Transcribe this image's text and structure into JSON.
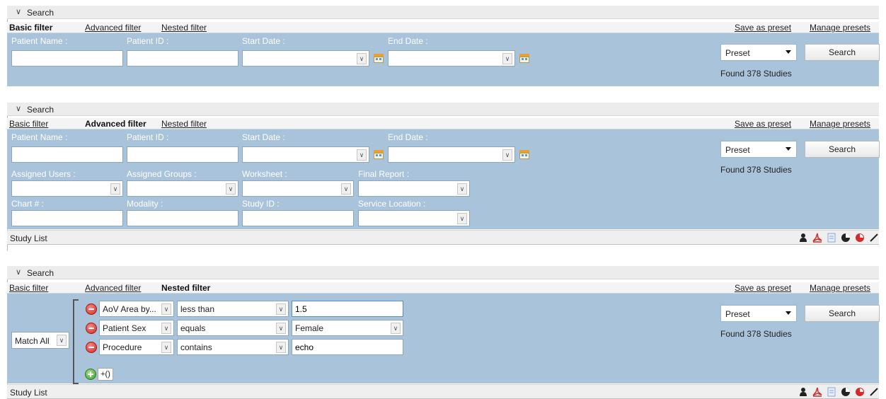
{
  "labels": {
    "search_header": "Search",
    "basic_filter": "Basic filter",
    "advanced_filter": "Advanced filter",
    "nested_filter": "Nested filter",
    "save_as_preset": "Save as preset",
    "manage_presets": "Manage presets",
    "patient_name": "Patient Name :",
    "patient_id": "Patient ID :",
    "start_date": "Start Date :",
    "end_date": "End Date :",
    "assigned_users": "Assigned Users :",
    "assigned_groups": "Assigned Groups :",
    "worksheet": "Worksheet :",
    "final_report": "Final Report :",
    "chart_num": "Chart # :",
    "modality": "Modality :",
    "study_id": "Study ID :",
    "service_location": "Service Location :",
    "preset": "Preset",
    "search_button": "Search",
    "found": "Found 378 Studies",
    "study_list": "Study List",
    "match_all": "Match All",
    "group_button": "+()"
  },
  "nested_rules": [
    {
      "field": "AoV Area by...",
      "operator": "less than",
      "value": "1.5",
      "value_type": "input"
    },
    {
      "field": "Patient Sex",
      "operator": "equals",
      "value": "Female",
      "value_type": "select"
    },
    {
      "field": "Procedure",
      "operator": "contains",
      "value": "echo",
      "value_type": "input"
    }
  ],
  "toolbar_icons": [
    "user-icon",
    "pdf-icon",
    "document-icon",
    "pie-chart-icon",
    "red-chart-icon",
    "pencil-icon"
  ],
  "colors": {
    "filter_bg": "#a9c3db",
    "label": "#ffffff"
  }
}
